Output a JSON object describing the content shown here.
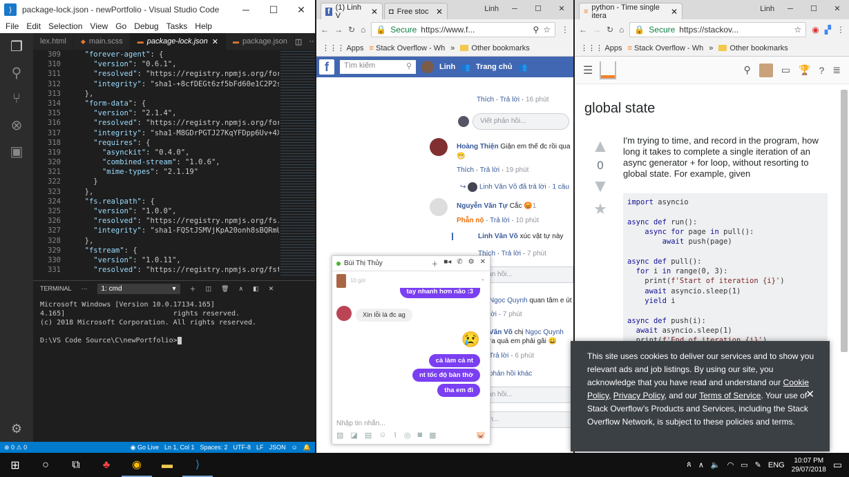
{
  "vscode": {
    "title": "package-lock.json - newPortfolio - Visual Studio Code",
    "menu": [
      "File",
      "Edit",
      "Selection",
      "View",
      "Go",
      "Debug",
      "Tasks",
      "Help"
    ],
    "tabs": [
      {
        "label": "lex.html",
        "active": false
      },
      {
        "label": "main.scss",
        "active": false
      },
      {
        "label": "package-lock.json",
        "active": true
      },
      {
        "label": "package.json",
        "active": false
      }
    ],
    "lines": [
      {
        "n": "309",
        "text": "  \"forever-agent\": {"
      },
      {
        "n": "310",
        "text": "    \"version\": \"0.6.1\","
      },
      {
        "n": "311",
        "text": "    \"resolved\": \"https://registry.npmjs.org/forev"
      },
      {
        "n": "312",
        "text": "    \"integrity\": \"sha1-+8cfDEGt6zf5bFd60e1C2P2sypE"
      },
      {
        "n": "313",
        "text": "  },"
      },
      {
        "n": "314",
        "text": "  \"form-data\": {"
      },
      {
        "n": "315",
        "text": "    \"version\": \"2.1.4\","
      },
      {
        "n": "316",
        "text": "    \"resolved\": \"https://registry.npmjs.org/form-d"
      },
      {
        "n": "317",
        "text": "    \"integrity\": \"sha1-M8GDrPGTJ27KqYFDpp6Uv+4XUNE"
      },
      {
        "n": "318",
        "text": "    \"requires\": {"
      },
      {
        "n": "319",
        "text": "      \"asynckit\": \"0.4.0\","
      },
      {
        "n": "320",
        "text": "      \"combined-stream\": \"1.0.6\","
      },
      {
        "n": "321",
        "text": "      \"mime-types\": \"2.1.19\""
      },
      {
        "n": "322",
        "text": "    }"
      },
      {
        "n": "323",
        "text": "  },"
      },
      {
        "n": "324",
        "text": "  \"fs.realpath\": {"
      },
      {
        "n": "325",
        "text": "    \"version\": \"1.0.0\","
      },
      {
        "n": "326",
        "text": "    \"resolved\": \"https://registry.npmjs.org/fs.rea"
      },
      {
        "n": "327",
        "text": "    \"integrity\": \"sha1-FQStJSMVjKpA20onh8sBQRmU6kE"
      },
      {
        "n": "328",
        "text": "  },"
      },
      {
        "n": "329",
        "text": "  \"fstream\": {"
      },
      {
        "n": "330",
        "text": "    \"version\": \"1.0.11\","
      },
      {
        "n": "331",
        "text": "    \"resolved\": \"https://registry.npmjs.org/fstrea"
      }
    ],
    "terminal": {
      "label": "TERMINAL",
      "more": "···",
      "select": "1: cmd",
      "output": "Microsoft Windows [Version 10.0.17134.165]\n4.165]                          rights reserved.\n(c) 2018 Microsoft Corporation. All rights reserved.\n\nD:\\VS Code Source\\C\\newPortfolio>"
    },
    "status": {
      "problems": "⊗ 0 ⚠ 0",
      "golive": "Go Live",
      "position": "Ln 1, Col 1",
      "spaces": "Spaces: 2",
      "encoding": "UTF-8",
      "eol": "LF",
      "lang": "JSON"
    }
  },
  "fb_browser": {
    "user": "Linh",
    "tabs": [
      {
        "label": "(1) Linh V",
        "icon": "f"
      },
      {
        "label": "Free stoc",
        "icon": "◘"
      }
    ],
    "secure": "Secure",
    "url": "https://www.f...",
    "bookmarks": {
      "apps": "Apps",
      "item": "Stack Overflow - Wh",
      "more": "»",
      "other": "Other bookmarks"
    },
    "nav": {
      "search": "Tìm kiếm",
      "name": "Linh",
      "home": "Trang chủ"
    },
    "feed": {
      "like1": "Thích",
      "reply1": "Trả lời",
      "time1": "16 phút",
      "write": "Viết phản hồi...",
      "author2": "Hoàng Thiện",
      "text2": "Giận em thế đc rồi qua",
      "like2": "Thích",
      "reply2": "Trả lời",
      "time2": "19 phút",
      "replies2": "Linh Văn Võ đã trả lời · 1 câu",
      "author3": "Nguyễn Văn Tự",
      "text3": "Cắc",
      "react3": "1",
      "angry3": "Phẫn nộ",
      "reply3": "Trả lời",
      "time3": "10 phút",
      "author4": "Linh Văn Võ",
      "text4": "xúc vật tự này",
      "like4": "Thích",
      "reply4": "Trả lời",
      "time4": "7 phút",
      "write4": "phản hồi...",
      "author5": "Ngọc Quynh",
      "text5": "quan tâm e út",
      "reply5": "lời",
      "time5": "7 phút",
      "author6": "Văn Võ",
      "text6a": "chị",
      "mention6": "Ngọc Quynh",
      "text6b": "ra quá em phải gãi",
      "reply6": "Trả lời",
      "time6": "6 phút",
      "more6": "phản hồi khác",
      "write6": "phản hồi...",
      "write7": "luận..."
    },
    "chat": {
      "name": "Bùi Thị Thủy",
      "time": "10 giờ",
      "m1": "tay nhanh hơn não :3",
      "m2": "Xin lỗi là đc ag",
      "m3": "cả làm cả nt",
      "m4": "nt tốc độ bàn thờ",
      "m5": "tha em đi",
      "input": "Nhập tin nhắn..."
    }
  },
  "so_browser": {
    "user": "Linh",
    "tab": "python - Time single itera",
    "secure": "Secure",
    "url": "https://stackov...",
    "bookmarks": {
      "apps": "Apps",
      "item": "Stack Overflow - Wh",
      "more": "»",
      "other": "Other bookmarks"
    },
    "question_title": "global state",
    "votes": "0",
    "body": "I'm trying to time, and record in the program, how long it takes to complete a single iteration of an async generator + for loop, without resorting to global state. For example, given",
    "code": "import asyncio\n\nasync def run():\n    async for page in pull():\n        await push(page)\n\nasync def pull():\n  for i in range(0, 3):\n    print(f'Start of iteration {i}')\n    await asyncio.sleep(1)\n    yield i\n\nasync def push(i):\n  await asyncio.sleep(1)\n  print(f'End of iteration {i}')",
    "cookie": {
      "p1": "This site uses cookies to deliver our services and to show you relevant ads and job listings. By using our site, you acknowledge that you have read and understand our ",
      "cookie_policy": "Cookie Policy",
      "sep1": ", ",
      "privacy_policy": "Privacy Policy",
      "sep2": ", and our ",
      "tos": "Terms of Service",
      "p2": ". Your use of Stack Overflow’s Products and Services, including the Stack Overflow Network, is subject to these policies and terms."
    }
  },
  "taskbar": {
    "lang": "ENG",
    "time": "10:07 PM",
    "date": "29/07/2018"
  }
}
